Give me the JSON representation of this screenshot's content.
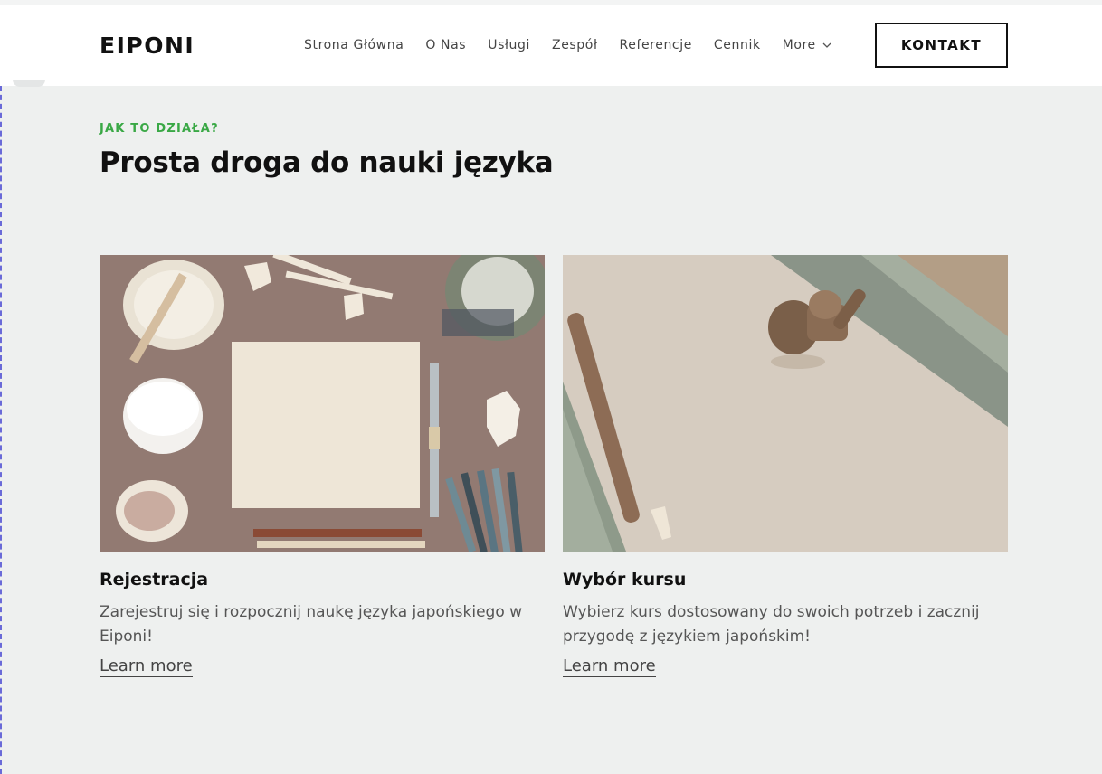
{
  "header": {
    "logo": "EIPONI",
    "nav": [
      "Strona Główna",
      "O Nas",
      "Usługi",
      "Zespół",
      "Referencje",
      "Cennik"
    ],
    "more_label": "More",
    "contact_label": "KONTAKT"
  },
  "section": {
    "eyebrow": "JAK TO DZIAŁA?",
    "heading": "Prosta droga do nauki języka"
  },
  "cards": [
    {
      "title": "Rejestracja",
      "description": "Zarejestruj się i rozpocznij naukę języka japońskiego w Eiponi!",
      "link": "Learn more"
    },
    {
      "title": "Wybór kursu",
      "description": "Wybierz kurs dostosowany do swoich potrzeb i zacznij przygodę z językiem japońskim!",
      "link": "Learn more"
    }
  ],
  "colors": {
    "accent": "#39a845",
    "page_bg": "#eef0ef",
    "header_bg": "#ffffff"
  },
  "icons": {
    "more_dropdown": "chevron-down-icon"
  }
}
